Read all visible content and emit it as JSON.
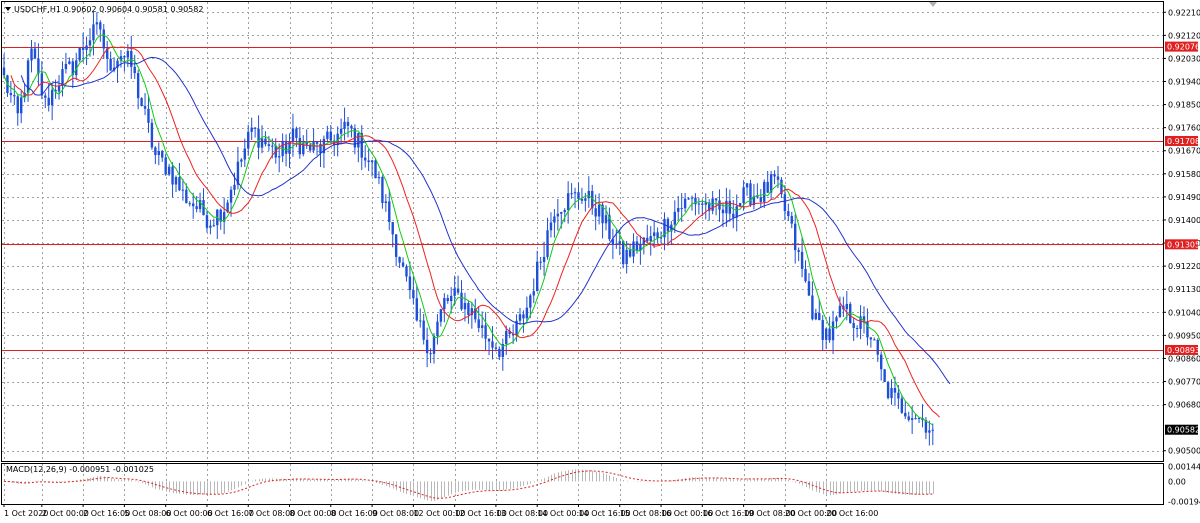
{
  "header": {
    "symbol_line": "USDCHF,H1  0.90602 0.90604 0.90581 0.90582"
  },
  "macd": {
    "label": "MACD(12,26,9) -0.000951 -0.001025",
    "axis_labels": [
      "0.001444",
      "0.00",
      "-0.001949"
    ],
    "range": [
      -0.0022,
      0.0017
    ]
  },
  "colors": {
    "background": "#ffffff",
    "candles": "#1e4fd8",
    "ma_fast": "#11cc11",
    "ma_mid": "#ee2222",
    "ma_slow": "#2233cc",
    "levels": "#e02020",
    "grid": "#a0a0a0",
    "price_tag": "#000000"
  },
  "chart_data": {
    "type": "candlestick",
    "instrument": "USDCHF",
    "timeframe": "H1",
    "ylim": [
      0.9046,
      0.9225
    ],
    "grid": true,
    "y_ticks": [
      "0.92210",
      "0.92120",
      "0.92030",
      "0.91940",
      "0.91850",
      "0.91760",
      "0.91670",
      "0.91580",
      "0.91490",
      "0.91400",
      "0.91310",
      "0.91220",
      "0.91130",
      "0.91040",
      "0.90950",
      "0.90860",
      "0.90770",
      "0.90680",
      "0.90500"
    ],
    "x_ticks": [
      "1 Oct 2020",
      "2 Oct 00:00",
      "2 Oct 16:00",
      "5 Oct 08:00",
      "6 Oct 00:00",
      "6 Oct 16:00",
      "7 Oct 08:00",
      "8 Oct 00:00",
      "8 Oct 16:00",
      "9 Oct 08:00",
      "12 Oct 00:00",
      "12 Oct 16:00",
      "13 Oct 08:00",
      "14 Oct 00:00",
      "14 Oct 16:00",
      "15 Oct 08:00",
      "16 Oct 00:00",
      "16 Oct 16:00",
      "19 Oct 08:00",
      "20 Oct 00:00",
      "20 Oct 16:00"
    ],
    "levels": [
      {
        "label": "0.92076",
        "value": 0.92076
      },
      {
        "label": "0.91708",
        "value": 0.91708
      },
      {
        "label": "0.91305",
        "value": 0.91305
      },
      {
        "label": "0.90893",
        "value": 0.90893
      }
    ],
    "current_price": {
      "label": "0.90582",
      "value": 0.90582
    },
    "close_path": [
      [
        0,
        0.9195
      ],
      [
        4,
        0.918
      ],
      [
        8,
        0.9205
      ],
      [
        12,
        0.9185
      ],
      [
        16,
        0.9195
      ],
      [
        20,
        0.92
      ],
      [
        24,
        0.921
      ],
      [
        28,
        0.9215
      ],
      [
        30,
        0.92
      ],
      [
        34,
        0.9205
      ],
      [
        37,
        0.92
      ],
      [
        40,
        0.9185
      ],
      [
        44,
        0.9165
      ],
      [
        48,
        0.916
      ],
      [
        52,
        0.915
      ],
      [
        56,
        0.9145
      ],
      [
        60,
        0.914
      ],
      [
        64,
        0.9145
      ],
      [
        68,
        0.916
      ],
      [
        72,
        0.9175
      ],
      [
        76,
        0.917
      ],
      [
        80,
        0.9165
      ],
      [
        84,
        0.9172
      ],
      [
        88,
        0.9168
      ],
      [
        92,
        0.9168
      ],
      [
        96,
        0.9172
      ],
      [
        100,
        0.9176
      ],
      [
        104,
        0.9168
      ],
      [
        108,
        0.9158
      ],
      [
        112,
        0.914
      ],
      [
        116,
        0.912
      ],
      [
        120,
        0.91
      ],
      [
        124,
        0.909
      ],
      [
        128,
        0.9108
      ],
      [
        132,
        0.911
      ],
      [
        136,
        0.9104
      ],
      [
        140,
        0.9095
      ],
      [
        144,
        0.909
      ],
      [
        148,
        0.9095
      ],
      [
        152,
        0.9106
      ],
      [
        156,
        0.9125
      ],
      [
        160,
        0.9145
      ],
      [
        164,
        0.9148
      ],
      [
        168,
        0.915
      ],
      [
        172,
        0.9145
      ],
      [
        176,
        0.9135
      ],
      [
        180,
        0.9125
      ],
      [
        184,
        0.913
      ],
      [
        188,
        0.9132
      ],
      [
        192,
        0.9138
      ],
      [
        196,
        0.9145
      ],
      [
        200,
        0.9148
      ],
      [
        204,
        0.9146
      ],
      [
        208,
        0.9143
      ],
      [
        212,
        0.9145
      ],
      [
        216,
        0.915
      ],
      [
        220,
        0.915
      ],
      [
        224,
        0.9155
      ],
      [
        228,
        0.914
      ],
      [
        232,
        0.912
      ],
      [
        236,
        0.91
      ],
      [
        240,
        0.9095
      ],
      [
        244,
        0.9105
      ],
      [
        248,
        0.91
      ],
      [
        252,
        0.9095
      ],
      [
        256,
        0.9075
      ],
      [
        260,
        0.9068
      ],
      [
        264,
        0.9065
      ],
      [
        268,
        0.9061
      ],
      [
        270,
        0.9058
      ]
    ],
    "x_count": 271,
    "x_tick_index": [
      0,
      11,
      23,
      35,
      47,
      59,
      71,
      83,
      95,
      107,
      119,
      131,
      143,
      155,
      167,
      179,
      191,
      203,
      215,
      227,
      239
    ]
  }
}
